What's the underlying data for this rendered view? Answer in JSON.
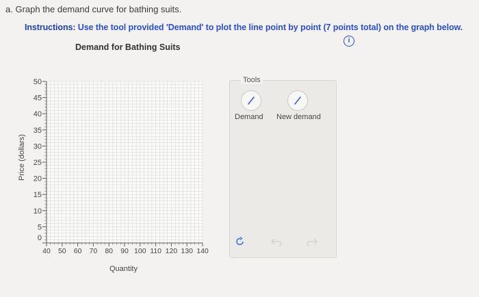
{
  "question": "a. Graph the demand curve for bathing suits.",
  "instructions": {
    "label": "Instructions:",
    "text": " Use the tool provided 'Demand' to plot the line point by point (7 points total) on the graph below."
  },
  "info_icon": "info-icon",
  "tools": {
    "title": "Tools",
    "demand_label": "Demand",
    "new_demand_label": "New demand",
    "icons": [
      "pencil-icon",
      "pencil-icon",
      "reset-icon",
      "undo-icon",
      "redo-icon"
    ]
  },
  "colors": {
    "instructions": "#2b4fd1",
    "tool_icon": "#3d5bd6",
    "reset_icon": "#4a6fe0",
    "grid": "#d9d9d9"
  },
  "chart_data": {
    "type": "scatter",
    "title": "Demand for Bathing Suits",
    "xlabel": "Quantity",
    "ylabel": "Price (dollars)",
    "xlim": [
      40,
      140
    ],
    "ylim": [
      0,
      50
    ],
    "xticks": [
      "40",
      "50",
      "60",
      "70",
      "80",
      "90",
      "100",
      "110",
      "120",
      "130",
      "140"
    ],
    "yticks": [
      "0",
      "5",
      "10",
      "15",
      "20",
      "25",
      "30",
      "35",
      "40",
      "45",
      "50"
    ],
    "grid": true,
    "series": []
  }
}
